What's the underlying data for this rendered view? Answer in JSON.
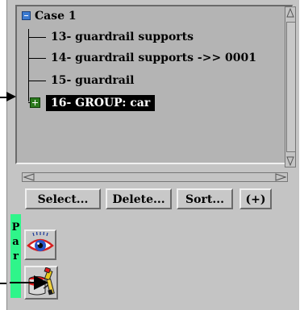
{
  "tree": {
    "root_label": "Case 1",
    "items": [
      {
        "label": "13- guardrail supports"
      },
      {
        "label": "14- guardrail supports ->> 0001"
      },
      {
        "label": "15- guardrail"
      },
      {
        "label": "16- GROUP: car",
        "selected": true,
        "expandable": true
      }
    ]
  },
  "buttons": {
    "select": "Select...",
    "delete": "Delete...",
    "sort": "Sort...",
    "plus": "(+)"
  },
  "side_tab": {
    "label_letters": [
      "P",
      "a",
      "r"
    ]
  },
  "icons": [
    "eye-icon",
    "paint-can-icon"
  ],
  "colors": {
    "panel": "#c4c4c4",
    "tree_bg": "#b4b4b4",
    "selection": "#000000",
    "tab_green": "#2ff58a",
    "expand_green": "#2b7a1d",
    "collapse_blue": "#3c7bd1"
  }
}
